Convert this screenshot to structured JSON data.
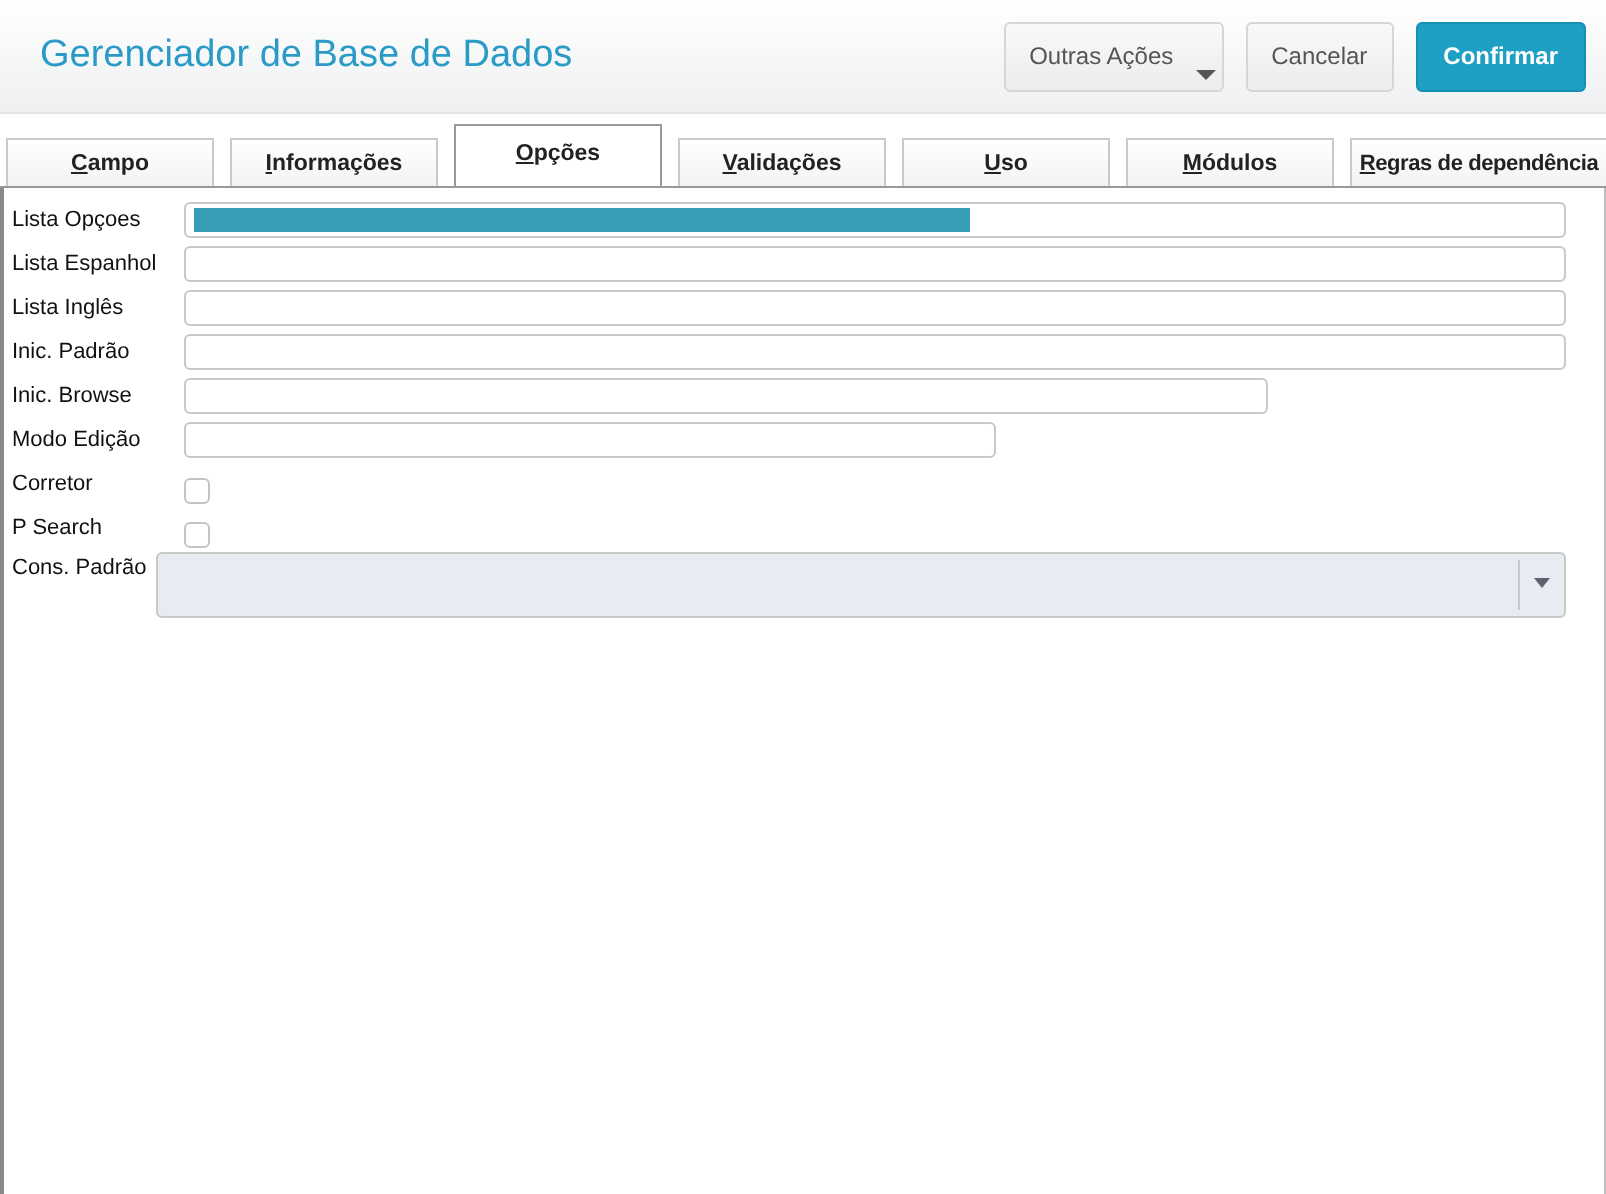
{
  "header": {
    "title": "Gerenciador de Base de Dados",
    "buttons": [
      {
        "label": "Outras Ações",
        "kind": "menu",
        "primary": false
      },
      {
        "label": "Cancelar",
        "kind": "plain",
        "primary": false
      },
      {
        "label": "Confirmar",
        "kind": "plain",
        "primary": true
      }
    ]
  },
  "tabs": [
    {
      "label": "Campo",
      "selected": false,
      "mnemonic": true
    },
    {
      "label": "Informações",
      "selected": false,
      "mnemonic": true
    },
    {
      "label": "Opções",
      "selected": true,
      "mnemonic": true
    },
    {
      "label": "Validações",
      "selected": false,
      "mnemonic": true
    },
    {
      "label": "Uso",
      "selected": false,
      "mnemonic": true
    },
    {
      "label": "Módulos",
      "selected": false,
      "mnemonic": true
    },
    {
      "label": "Regras de dependência",
      "selected": false,
      "mnemonic": true
    }
  ],
  "fields": [
    {
      "label": "Lista Opçoes",
      "kind": "wide",
      "level": 0.57
    },
    {
      "label": "Lista Espanhol",
      "kind": "wide"
    },
    {
      "label": "Lista Inglês",
      "kind": "wide"
    },
    {
      "label": "Inic. Padrão",
      "kind": "wide"
    },
    {
      "label": "Inic. Browse",
      "kind": "medium"
    },
    {
      "label": "Modo Edição",
      "kind": "narrow"
    },
    {
      "label": "Corretor",
      "kind": "checkbox",
      "checked": false
    },
    {
      "label": "P Search",
      "kind": "checkbox",
      "checked": false
    },
    {
      "label": "Cons. Padrão",
      "kind": "combo"
    }
  ]
}
